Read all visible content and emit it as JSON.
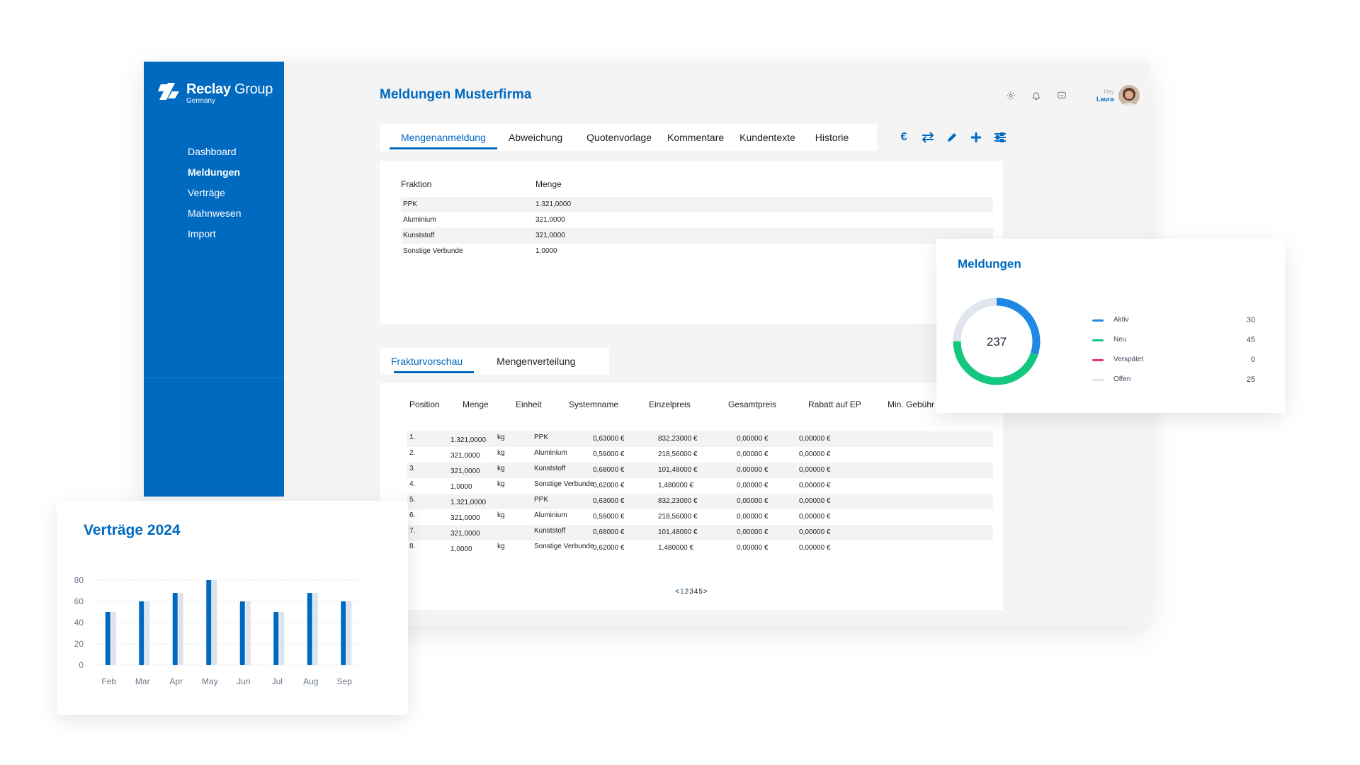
{
  "sidebar": {
    "logo": {
      "brand": "Reclay",
      "brand_suffix": "Group",
      "sub": "Germany"
    },
    "items": [
      {
        "label": "Dashboard",
        "active": false
      },
      {
        "label": "Meldungen",
        "active": true
      },
      {
        "label": "Verträge",
        "active": false
      },
      {
        "label": "Mahnwesen",
        "active": false
      },
      {
        "label": "Import",
        "active": false
      }
    ]
  },
  "header": {
    "title": "Meldungen Musterfirma",
    "icons": [
      "gear-icon",
      "bell-icon",
      "message-icon"
    ],
    "user": {
      "greeting": "Hey",
      "name": "Laura"
    }
  },
  "tabs_top": [
    {
      "label": "Mengenanmeldung",
      "active": true
    },
    {
      "label": "Abweichung",
      "active": false
    },
    {
      "label": "Quotenvorlage",
      "active": false
    },
    {
      "label": "Kommentare",
      "active": false
    },
    {
      "label": "Kundentexte",
      "active": false
    },
    {
      "label": "Historie",
      "active": false
    }
  ],
  "toolbar": {
    "euro_label": "€",
    "icons": [
      "euro-icon",
      "swap-icon",
      "pencil-icon",
      "plus-icon",
      "sliders-icon"
    ]
  },
  "fraktion_table": {
    "headers": [
      "Fraktion",
      "Menge"
    ],
    "rows": [
      [
        "PPK",
        "1.321,0000"
      ],
      [
        "Aluminium",
        "321,0000"
      ],
      [
        "Kunststoff",
        "321,0000"
      ],
      [
        "Sonstige Verbunde",
        "1,0000"
      ]
    ]
  },
  "tabs_bottom": [
    {
      "label": "Frakturvorschau",
      "active": true
    },
    {
      "label": "Mengenverteilung",
      "active": false
    }
  ],
  "faktura_table": {
    "headers": [
      "Position",
      "Menge",
      "Einheit",
      "Systemname",
      "Einzelpreis",
      "Gesamtpreis",
      "Rabatt auf EP",
      "Min. Gebühr"
    ],
    "rows": [
      [
        "1.",
        "1.321,0000",
        "kg",
        "PPK",
        "0,63000 €",
        "832,23000 €",
        "0,00000 €",
        "0,00000 €"
      ],
      [
        "2.",
        "321,0000",
        "kg",
        "Aluminium",
        "0,59000 €",
        "218,56000 €",
        "0,00000 €",
        "0,00000 €"
      ],
      [
        "3.",
        "321,0000",
        "kg",
        "Kunststoff",
        "0,68000 €",
        "101,48000 €",
        "0,00000 €",
        "0,00000 €"
      ],
      [
        "4.",
        "1,0000",
        "kg",
        "Sonstige Verbunde",
        "0,62000 €",
        "1,480000 €",
        "0,00000 €",
        "0,00000 €"
      ],
      [
        "5.",
        "1.321,0000",
        "",
        "PPK",
        "0,63000 €",
        "832,23000 €",
        "0,00000 €",
        "0,00000 €"
      ],
      [
        "6.",
        "321,0000",
        "kg",
        "Aluminium",
        "0,59000 €",
        "218,56000 €",
        "0,00000 €",
        "0,00000 €"
      ],
      [
        "7.",
        "321,0000",
        "",
        "Kunststoff",
        "0,68000 €",
        "101,48000 €",
        "0,00000 €",
        "0,00000 €"
      ],
      [
        "8.",
        "1,0000",
        "kg",
        "Sonstige Verbunde",
        "0,62000 €",
        "1,480000 €",
        "0,00000 €",
        "0,00000 €"
      ]
    ],
    "pagination": {
      "prev": "<",
      "pages": [
        "1",
        "2",
        "3",
        "4",
        "5"
      ],
      "current": "1",
      "next": ">"
    }
  },
  "meldungen_card": {
    "title": "Meldungen",
    "total": "237",
    "legend": [
      {
        "name": "Aktiv",
        "value": "30",
        "color": "#1e88e5"
      },
      {
        "name": "Neu",
        "value": "45",
        "color": "#14c77f"
      },
      {
        "name": "Verspätet",
        "value": "0",
        "color": "#e8336b"
      },
      {
        "name": "Offen",
        "value": "25",
        "color": "#e1e5ec"
      }
    ]
  },
  "chart_data": {
    "type": "bar",
    "title": "Verträge 2024",
    "categories": [
      "Feb",
      "Mar",
      "Apr",
      "May",
      "Jun",
      "Jul",
      "Aug",
      "Sep"
    ],
    "series": [
      {
        "values": [
          50,
          60,
          68,
          80,
          60,
          50,
          68,
          60
        ],
        "color": "#0069c0"
      },
      {
        "values": [
          50,
          60,
          68,
          80,
          60,
          50,
          68,
          60
        ],
        "color": "#dde3ec"
      }
    ],
    "yticks": [
      0,
      20,
      40,
      60,
      80
    ],
    "ylim": [
      0,
      80
    ],
    "grid": true
  },
  "colors": {
    "brand": "#0069c0",
    "background": "#f4f4f4"
  }
}
